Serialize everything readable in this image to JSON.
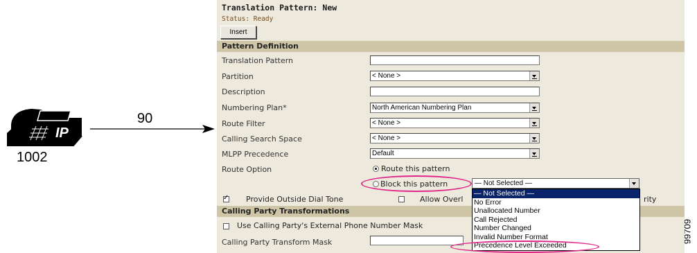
{
  "diagram": {
    "extension": "1002",
    "dialed_digits": "90",
    "phone_screen_label": "IP",
    "figure_id": "99709"
  },
  "header": {
    "title": "Translation Pattern: New",
    "status": "Status: Ready",
    "insert_label": "Insert"
  },
  "pattern_definition": {
    "section_title": "Pattern Definition",
    "translation_pattern": {
      "label": "Translation Pattern",
      "value": ""
    },
    "partition": {
      "label": "Partition",
      "value": "< None >"
    },
    "description": {
      "label": "Description",
      "value": ""
    },
    "numbering_plan": {
      "label": "Numbering Plan*",
      "value": "North American Numbering Plan"
    },
    "route_filter": {
      "label": "Route Filter",
      "value": "< None >"
    },
    "calling_search_space": {
      "label": "Calling Search Space",
      "value": "< None >"
    },
    "mlpp_precedence": {
      "label": "MLPP Precedence",
      "value": "Default"
    },
    "route_option": {
      "label": "Route Option",
      "route_label": "Route this pattern",
      "block_label": "Block this pattern",
      "selected": "route"
    },
    "block_reason": {
      "value": "— Not Selected —",
      "options": [
        "— Not Selected —",
        "No Error",
        "Unallocated Number",
        "Call Rejected",
        "Number Changed",
        "Invalid Number Format",
        "Precedence Level Exceeded"
      ],
      "highlighted_index": 0
    },
    "provide_outside_dial_tone": {
      "label": "Provide Outside Dial Tone",
      "checked": true
    },
    "allow_overlap": {
      "label": "Allow Overl",
      "checked": false
    },
    "urgent_priority_tail": "rity"
  },
  "calling_party": {
    "section_title": "Calling Party Transformations",
    "use_external_mask": {
      "label": "Use Calling Party's External Phone Number Mask",
      "checked": false
    },
    "transform_mask": {
      "label": "Calling Party Transform Mask",
      "value": ""
    }
  },
  "colors": {
    "panel_bg": "#ede9dc",
    "section_bg": "#cfc6a7",
    "highlight_oval": "#e0268a",
    "list_selected": "#0a246a"
  }
}
